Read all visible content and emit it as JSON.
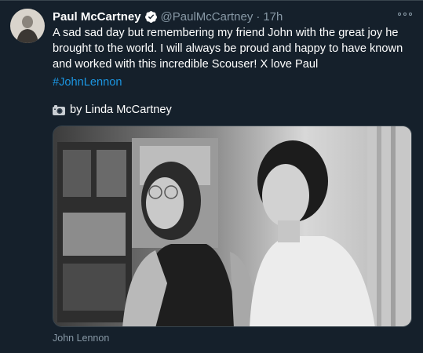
{
  "tweet": {
    "author_name": "Paul McCartney",
    "author_handle": "@PaulMcCartney",
    "separator": "·",
    "timestamp": "17h",
    "text": "A sad sad day but remembering my friend John with the great joy he brought to the world. I will always be proud and happy to have known and worked with this incredible Scouser! X love Paul",
    "hashtag": "#JohnLennon",
    "credit_text": "by Linda McCartney",
    "media_caption": "John Lennon",
    "icons": {
      "verified": "verified-badge-icon",
      "more": "more-options-icon",
      "camera": "camera-icon"
    }
  },
  "colors": {
    "background": "#15202b",
    "secondary_text": "#8899a6",
    "link": "#1b95e0",
    "border": "#38444d"
  }
}
